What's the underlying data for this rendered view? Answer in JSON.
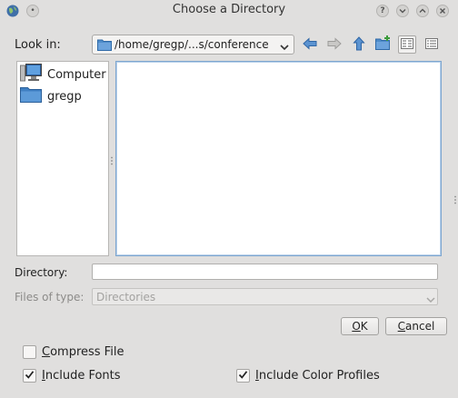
{
  "window": {
    "title": "Choose a Directory",
    "buttons": {
      "help": "?",
      "minimize": "⌄",
      "maximize": "⌃",
      "close": "✕"
    }
  },
  "look_in": {
    "label": "Look in:",
    "path": "/home/gregp/...s/conference"
  },
  "toolbar": {
    "icons": [
      "back-arrow-icon",
      "forward-arrow-icon",
      "up-arrow-icon",
      "new-folder-icon",
      "list-view-icon",
      "detail-view-icon"
    ]
  },
  "sidebar": {
    "items": [
      {
        "label": "Computer",
        "icon": "computer-icon"
      },
      {
        "label": "gregp",
        "icon": "folder-icon"
      }
    ]
  },
  "directory": {
    "label": "Directory:",
    "value": ""
  },
  "files_of_type": {
    "label": "Files of type:",
    "value": "Directories"
  },
  "buttons": {
    "ok_u": "O",
    "ok_rest": "K",
    "cancel_u": "C",
    "cancel_rest": "ancel"
  },
  "options": [
    {
      "u": "C",
      "rest": "ompress File",
      "checked": false
    },
    {
      "u": "I",
      "rest": "nclude Fonts",
      "checked": true
    },
    {
      "u": "I",
      "rest": "nclude Color Profiles",
      "checked": true
    }
  ],
  "colors": {
    "accent": "#4a86c8",
    "folder": "#4f8cc9",
    "focus_border": "#7ea6cf"
  }
}
